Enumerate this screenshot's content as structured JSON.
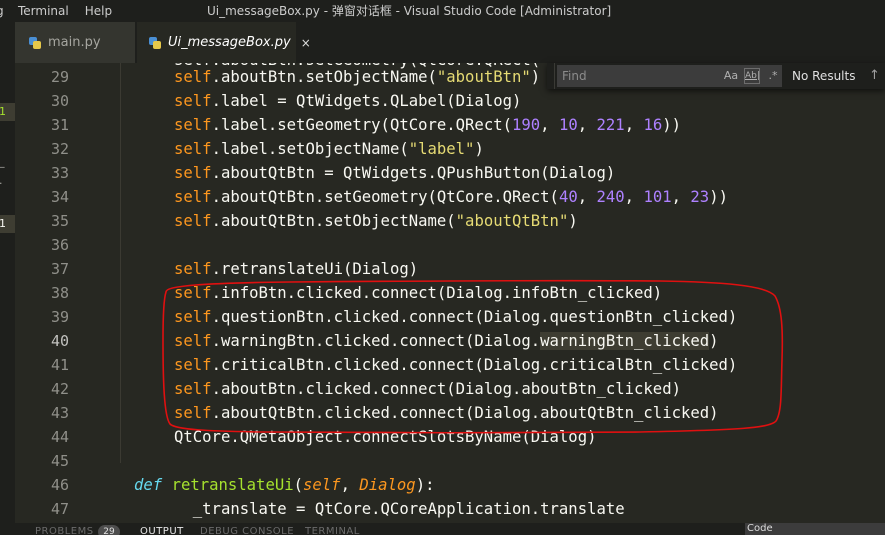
{
  "menu": {
    "cut_item": "g",
    "items": [
      "Terminal",
      "Help"
    ]
  },
  "window_title": "Ui_messageBox.py - 弹窗对话框 - Visual Studio Code [Administrator]",
  "tabs": [
    {
      "label": "main.py",
      "active": false
    },
    {
      "label": "Ui_messageBox.py",
      "active": true,
      "close": "×"
    }
  ],
  "activity_marks": [
    "1",
    "1"
  ],
  "find": {
    "placeholder": "Find",
    "match_case": "Aa",
    "whole_word": "Ab|",
    "regex": ".*",
    "results": "No Results",
    "prev": "↑"
  },
  "gutter": {
    "lines": [
      "29",
      "30",
      "31",
      "32",
      "33",
      "34",
      "35",
      "36",
      "37",
      "38",
      "39",
      "40",
      "41",
      "42",
      "43",
      "44",
      "45",
      "46",
      "47"
    ],
    "current": "40"
  },
  "code": {
    "top_partial": "self.aboutBtn.setGeometry(QtCore.QRect(",
    "lines": [
      {
        "self": "self",
        "rest": ".aboutBtn.setObjectName(",
        "str": "\"aboutBtn\"",
        "tail": ")"
      },
      {
        "self": "self",
        "rest": ".label = QtWidgets.QLabel(Dialog)"
      },
      {
        "self": "self",
        "rest": ".label.setGeometry(QtCore.QRect(",
        "n1": "190",
        "n2": "10",
        "n3": "221",
        "n4": "16",
        "tail": "))"
      },
      {
        "self": "self",
        "rest": ".label.setObjectName(",
        "str": "\"label\"",
        "tail": ")"
      },
      {
        "self": "self",
        "rest": ".aboutQtBtn = QtWidgets.QPushButton(Dialog)"
      },
      {
        "self": "self",
        "rest": ".aboutQtBtn.setGeometry(QtCore.QRect(",
        "n1": "40",
        "n2": "240",
        "n3": "101",
        "n4": "23",
        "tail": "))"
      },
      {
        "self": "self",
        "rest": ".aboutQtBtn.setObjectName(",
        "str": "\"aboutQtBtn\"",
        "tail": ")"
      },
      {
        "blank": true
      },
      {
        "self": "self",
        "rest": ".retranslateUi(Dialog)"
      },
      {
        "self": "self",
        "rest": ".infoBtn.clicked.connect(Dialog.infoBtn_clicked)"
      },
      {
        "self": "self",
        "rest": ".questionBtn.clicked.connect(Dialog.questionBtn_clicked)"
      },
      {
        "self": "self",
        "rest": ".warningBtn.clicked.connect(Dialog.",
        "hl": "warningBtn_clicked",
        "tail": ")"
      },
      {
        "self": "self",
        "rest": ".criticalBtn.clicked.connect(Dialog.criticalBtn_clicked)"
      },
      {
        "self": "self",
        "rest": ".aboutBtn.clicked.connect(Dialog.aboutBtn_clicked)"
      },
      {
        "self": "self",
        "rest": ".aboutQtBtn.clicked.connect(Dialog.aboutQtBtn_clicked)"
      },
      {
        "rest": "QtCore.QMetaObject.connectSlotsByName(Dialog)"
      },
      {
        "blank": true
      },
      {
        "kw": "def",
        "fn": "retranslateUi",
        "p1": "self",
        "p2": "Dialog",
        "tail": "):"
      },
      {
        "rest": "  _translate = QtCore.QCoreApplication.translate"
      }
    ]
  },
  "panel": {
    "tabs": [
      "PROBLEMS",
      "OUTPUT",
      "DEBUG CONSOLE",
      "TERMINAL"
    ],
    "active": "OUTPUT",
    "badge": "29",
    "right_text": "Code"
  },
  "colors": {
    "background": "#272822",
    "self": "#fd971f",
    "string": "#e6db74",
    "number": "#ae81ff",
    "keyword": "#66d9ef",
    "function": "#a6e22e",
    "annotation": "#e01010"
  }
}
